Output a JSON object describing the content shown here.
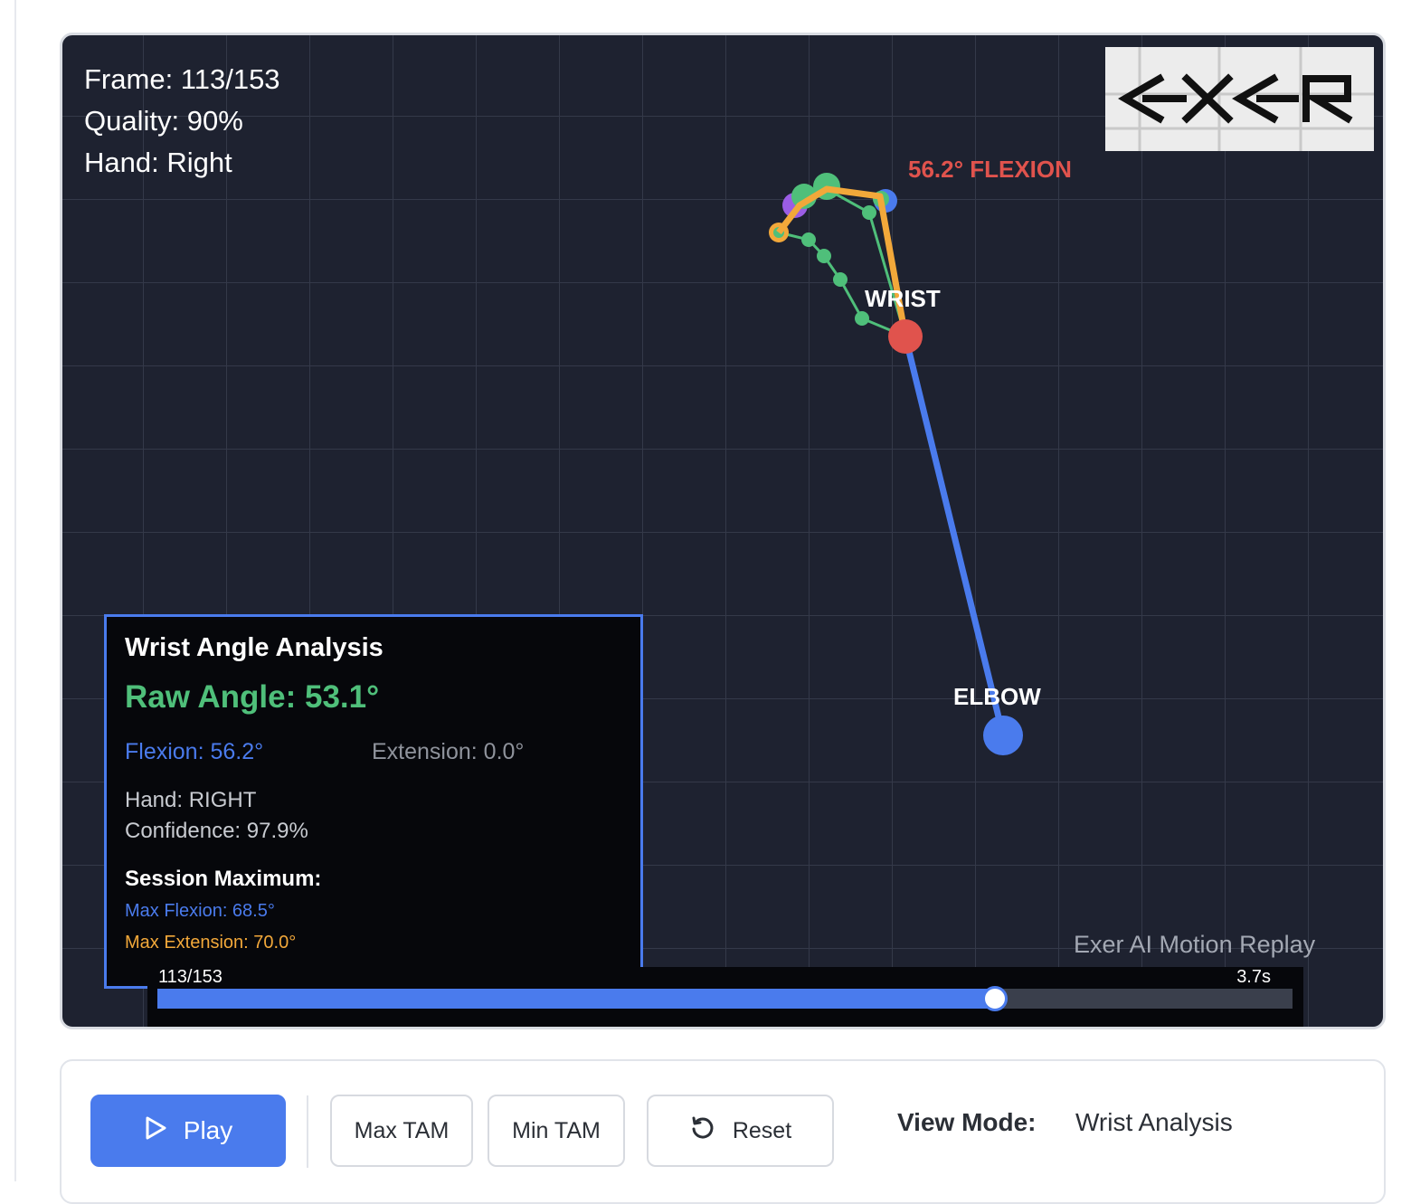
{
  "overlay": {
    "frame": "Frame: 113/153",
    "quality": "Quality: 90%",
    "hand": "Hand: Right"
  },
  "logo_text": "EXER",
  "flexion_label": "56.2° FLEXION",
  "joints": {
    "wrist": "WRIST",
    "elbow": "ELBOW"
  },
  "panel": {
    "title": "Wrist Angle Analysis",
    "raw_angle": "Raw Angle: 53.1°",
    "flexion": "Flexion: 56.2°",
    "extension": "Extension: 0.0°",
    "hand": "Hand: RIGHT",
    "confidence": "Confidence: 97.9%",
    "session_title": "Session Maximum:",
    "max_flexion": "Max Flexion: 68.5°",
    "max_extension": "Max Extension: 70.0°"
  },
  "watermark": "Exer AI Motion Replay",
  "timeline": {
    "frame_label": "113/153",
    "time_label": "3.7s",
    "progress": 0.738
  },
  "controls": {
    "play": "Play",
    "max_tam": "Max TAM",
    "min_tam": "Min TAM",
    "reset": "Reset",
    "view_mode_label": "View Mode:",
    "view_mode_value": "Wrist Analysis"
  },
  "colors": {
    "canvas_bg": "#1e2230",
    "accent_blue": "#4a7bed",
    "flexion_red": "#e0534d",
    "raw_green": "#4fbf7a",
    "extension_orange": "#f2a83a"
  },
  "icons": {
    "play": "play-icon",
    "reset": "reset-icon"
  }
}
